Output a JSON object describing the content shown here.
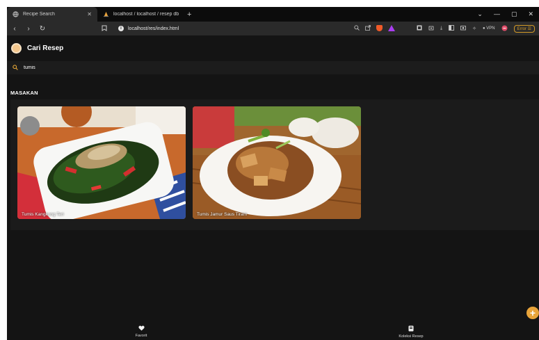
{
  "browser": {
    "tabs": [
      {
        "title": "Recipe Search",
        "active": true
      },
      {
        "title": "localhost / localhost / resep db / re",
        "active": false
      }
    ],
    "new_tab": "+",
    "url": "localhost/res/index.html",
    "error_button": "Error",
    "vpn_label": "VPN"
  },
  "app": {
    "title": "Cari Resep",
    "search": {
      "value": "tumis",
      "placeholder": ""
    },
    "section_title": "MASAKAN",
    "recipes": [
      {
        "name": "Tumis Kangkung Teri"
      },
      {
        "name": "Tumis Jamur Saus Tiram"
      }
    ],
    "bottom_nav": [
      {
        "label": "Favorit",
        "icon": "heart-icon"
      },
      {
        "label": "Koleksi Resep",
        "icon": "book-icon"
      }
    ],
    "fab_label": "+",
    "colors": {
      "accent": "#e9a43a",
      "background": "#141414"
    }
  }
}
